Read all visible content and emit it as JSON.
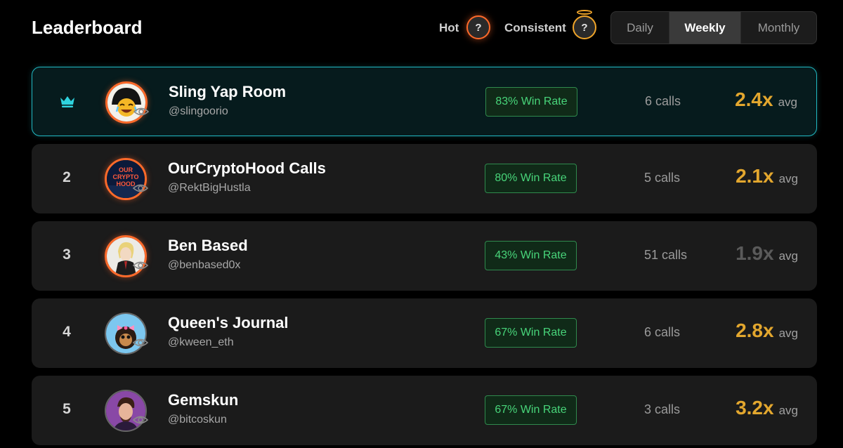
{
  "header": {
    "title": "Leaderboard",
    "legend": {
      "hot_label": "Hot",
      "consistent_label": "Consistent",
      "help_glyph": "?"
    },
    "tabs": [
      {
        "label": "Daily",
        "active": false
      },
      {
        "label": "Weekly",
        "active": true
      },
      {
        "label": "Monthly",
        "active": false
      }
    ]
  },
  "colors": {
    "background": "#000000",
    "row": "#1b1b1b",
    "first_row": "#061b1d",
    "first_border": "#21b9c2",
    "hot_ring": "#ff6a2a",
    "consistent_ring": "#f0a52a",
    "win_rate_text": "#48d57a",
    "multiplier": "#e3a72e",
    "multiplier_dim": "#5a5a5a"
  },
  "rows": [
    {
      "rank": "1",
      "rank_icon": "crown-icon",
      "name": "Sling Yap Room",
      "handle": "@slingoorio",
      "win_rate": "83% Win Rate",
      "calls": "6 calls",
      "multiplier": "2.4x",
      "multiplier_unit": "avg",
      "hot": true,
      "dim": false
    },
    {
      "rank": "2",
      "name": "OurCryptoHood Calls",
      "handle": "@RektBigHustla",
      "win_rate": "80% Win Rate",
      "calls": "5 calls",
      "multiplier": "2.1x",
      "multiplier_unit": "avg",
      "hot": true,
      "dim": false
    },
    {
      "rank": "3",
      "name": "Ben Based",
      "handle": "@benbased0x",
      "win_rate": "43% Win Rate",
      "calls": "51 calls",
      "multiplier": "1.9x",
      "multiplier_unit": "avg",
      "hot": true,
      "dim": true
    },
    {
      "rank": "4",
      "name": "Queen's Journal",
      "handle": "@kween_eth",
      "win_rate": "67% Win Rate",
      "calls": "6 calls",
      "multiplier": "2.8x",
      "multiplier_unit": "avg",
      "hot": false,
      "dim": false
    },
    {
      "rank": "5",
      "name": "Gemskun",
      "handle": "@bitcoskun",
      "win_rate": "67% Win Rate",
      "calls": "3 calls",
      "multiplier": "3.2x",
      "multiplier_unit": "avg",
      "hot": false,
      "dim": false
    }
  ]
}
